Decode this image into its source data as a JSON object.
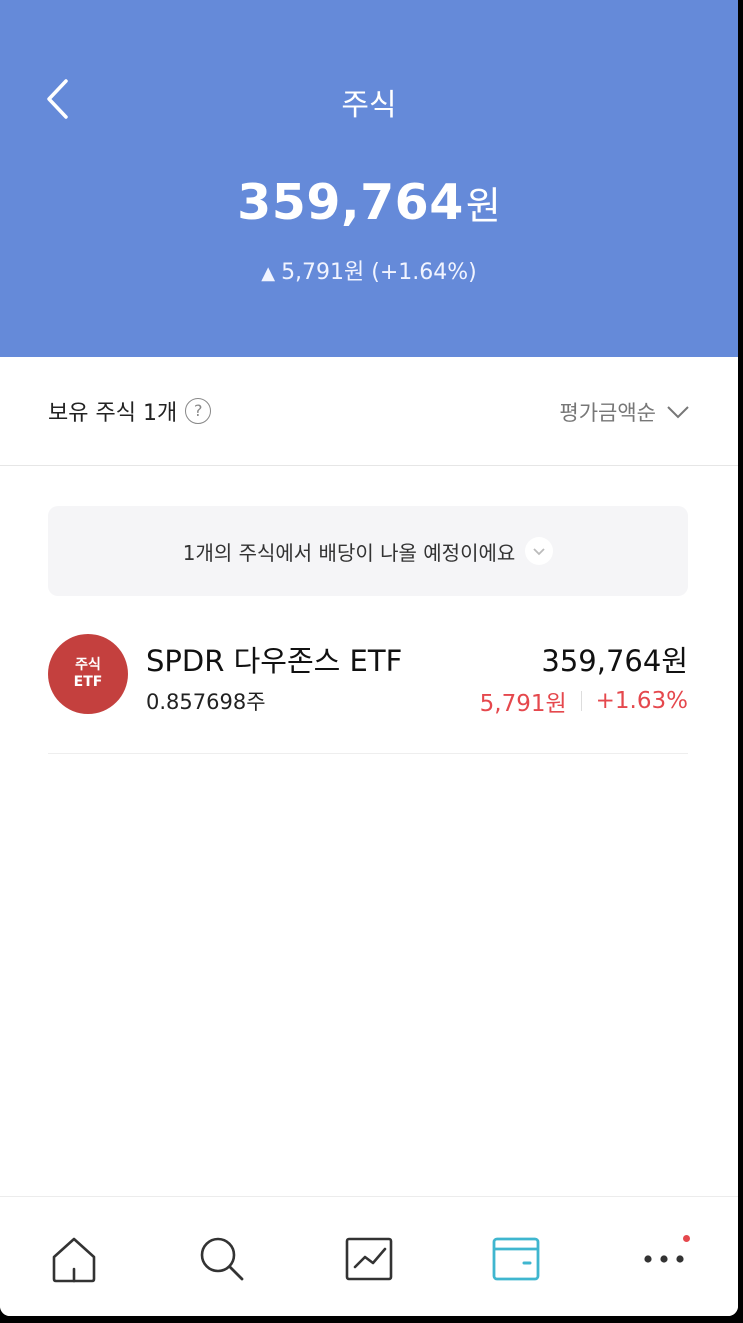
{
  "header": {
    "title": "주식",
    "total_amount": "359,764",
    "total_unit": "원",
    "change_text": "5,791원 (+1.64%)",
    "change_direction_icon": "triangle-up-icon",
    "background_color": "#658ad9"
  },
  "holdings": {
    "label": "보유 주식 1개",
    "help_icon": "question-circle-icon",
    "sort_label": "평가금액순"
  },
  "dividend_banner": {
    "text": "1개의 주식에서 배당이 나올 예정이에요"
  },
  "stocks": [
    {
      "logo_line1": "주식",
      "logo_line2": "ETF",
      "name": "SPDR 다우존스 ETF",
      "quantity": "0.857698주",
      "value": "359,764원",
      "change_amount": "5,791원",
      "change_percent": "+1.63%",
      "logo_color": "#c4403e",
      "change_color": "#e5484d"
    }
  ],
  "tabbar": {
    "items": [
      "home-icon",
      "search-icon",
      "chart-icon",
      "wallet-icon",
      "more-icon"
    ],
    "active": "wallet-icon",
    "active_color": "#3fb6cf",
    "badge_color": "#e5484d"
  }
}
